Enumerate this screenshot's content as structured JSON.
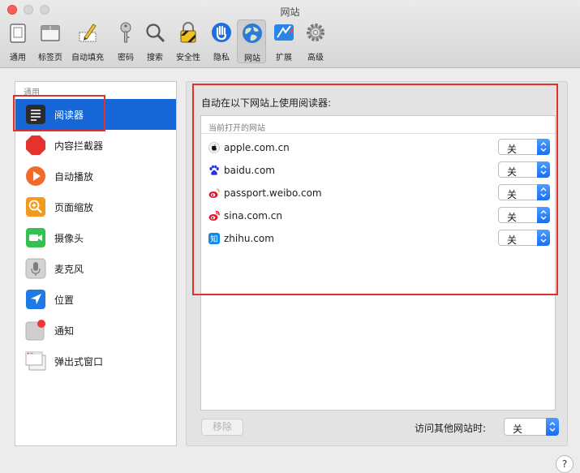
{
  "window": {
    "title": "网站"
  },
  "toolbar": {
    "items": [
      {
        "label": "通用",
        "icon": "general-icon"
      },
      {
        "label": "标签页",
        "icon": "tabs-icon"
      },
      {
        "label": "自动填充",
        "icon": "autofill-icon"
      },
      {
        "label": "密码",
        "icon": "key-icon"
      },
      {
        "label": "搜索",
        "icon": "search-icon"
      },
      {
        "label": "安全性",
        "icon": "security-icon"
      },
      {
        "label": "隐私",
        "icon": "privacy-hand-icon"
      },
      {
        "label": "网站",
        "icon": "globe-icon",
        "active": true
      },
      {
        "label": "扩展",
        "icon": "extensions-icon"
      },
      {
        "label": "高级",
        "icon": "gear-icon"
      }
    ]
  },
  "sidebar": {
    "header": "通用",
    "items": [
      {
        "label": "阅读器",
        "icon": "reader-icon",
        "selected": true
      },
      {
        "label": "内容拦截器",
        "icon": "content-blocker-icon"
      },
      {
        "label": "自动播放",
        "icon": "autoplay-icon"
      },
      {
        "label": "页面缩放",
        "icon": "page-zoom-icon"
      },
      {
        "label": "摄像头",
        "icon": "camera-icon"
      },
      {
        "label": "麦克风",
        "icon": "microphone-icon"
      },
      {
        "label": "位置",
        "icon": "location-icon"
      },
      {
        "label": "通知",
        "icon": "notifications-icon"
      },
      {
        "label": "弹出式窗口",
        "icon": "popup-window-icon"
      }
    ]
  },
  "main": {
    "title": "自动在以下网站上使用阅读器:",
    "list_header": "当前打开的网站",
    "sites": [
      {
        "domain": "apple.com.cn",
        "value": "关",
        "icon": "apple-icon"
      },
      {
        "domain": "baidu.com",
        "value": "关",
        "icon": "baidu-icon"
      },
      {
        "domain": "passport.weibo.com",
        "value": "关",
        "icon": "weibo-icon"
      },
      {
        "domain": "sina.com.cn",
        "value": "关",
        "icon": "sina-icon"
      },
      {
        "domain": "zhihu.com",
        "value": "关",
        "icon": "zhihu-icon"
      }
    ],
    "zhihu_glyph": "知",
    "remove_label": "移除",
    "other_label": "访问其他网站时:",
    "other_value": "关"
  },
  "help_label": "?",
  "colors": {
    "selection": "#1766d7",
    "highlight": "#e2302e",
    "accent": "#1a6ff2"
  }
}
